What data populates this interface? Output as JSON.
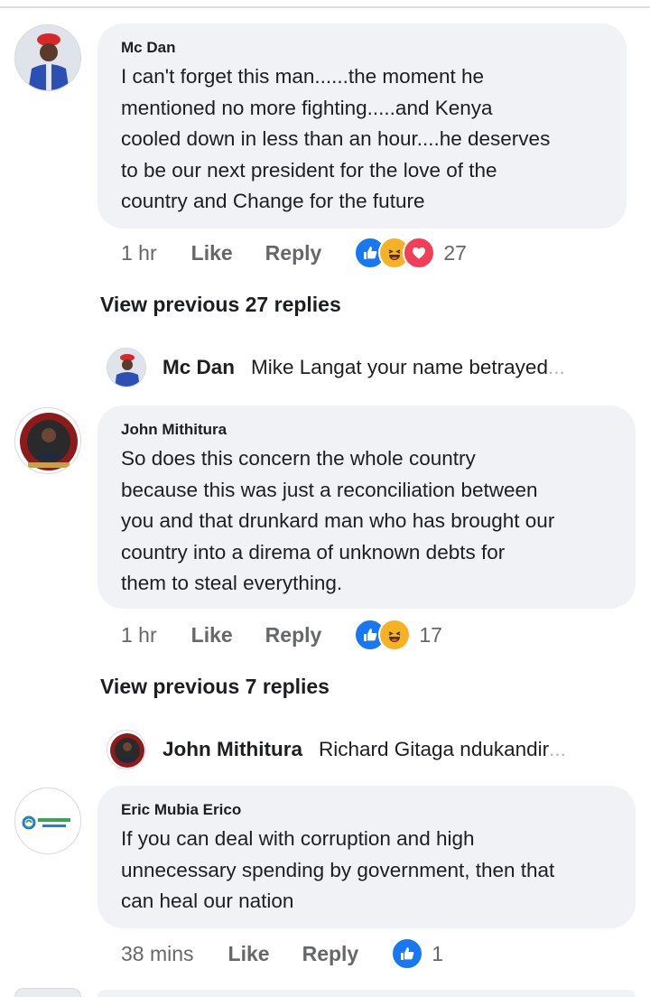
{
  "comments": [
    {
      "author": "Mc Dan",
      "lines": [
        "I can't forget this man......the moment he",
        "mentioned no more fighting.....and Kenya",
        "cooled down in less than an hour....he deserves",
        "to be our next president for the love of the",
        "country and Change for the future"
      ],
      "time": "1 hr",
      "like_label": "Like",
      "reply_label": "Reply",
      "reactions": [
        "like-icon",
        "haha-icon",
        "love-icon"
      ],
      "reaction_count": "27",
      "view_previous": "View previous 27 replies",
      "latest_reply": {
        "name": "Mc Dan",
        "snippet": "Mike Langat your name betrayed",
        "ellipsis": "..."
      }
    },
    {
      "author": "John Mithitura",
      "lines": [
        "So does this concern the whole country",
        "because this was just a reconciliation between",
        "you and that drunkard man who has brought our",
        "country into a direma of unknown debts for",
        "them to steal everything."
      ],
      "time": "1 hr",
      "like_label": "Like",
      "reply_label": "Reply",
      "reactions": [
        "like-icon",
        "haha-icon"
      ],
      "reaction_count": "17",
      "view_previous": "View previous 7 replies",
      "latest_reply": {
        "name": "John Mithitura",
        "snippet": "Richard Gitaga ndukandir",
        "ellipsis": "..."
      }
    },
    {
      "author": "Eric Mubia Erico",
      "lines": [
        "If you can deal with corruption and high",
        "unnecessary spending by government, then that",
        "can heal our nation"
      ],
      "time": "38 mins",
      "like_label": "Like",
      "reply_label": "Reply",
      "reactions": [
        "like-icon"
      ],
      "reaction_count": "1"
    }
  ],
  "colors": {
    "like": "#1877f2",
    "haha": "#f7b125",
    "love": "#f33e58",
    "bubble": "#f0f2f5",
    "meta_text": "#65676b"
  }
}
